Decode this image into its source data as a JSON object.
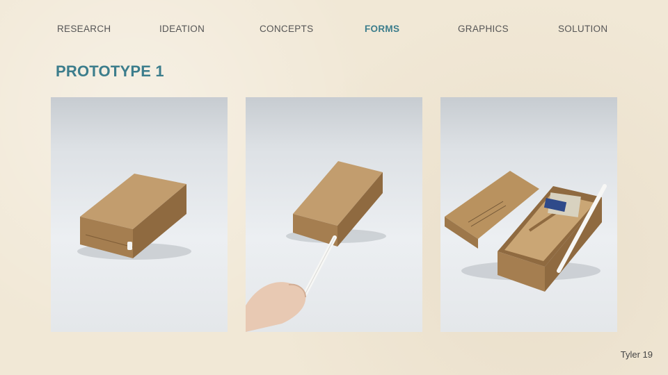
{
  "nav": {
    "items": [
      {
        "label": "RESEARCH"
      },
      {
        "label": "IDEATION"
      },
      {
        "label": "CONCEPTS"
      },
      {
        "label": "FORMS"
      },
      {
        "label": "GRAPHICS"
      },
      {
        "label": "SOLUTION"
      }
    ],
    "active_index": 3
  },
  "page": {
    "title": "PROTOTYPE 1",
    "footer": "Tyler 19"
  },
  "colors": {
    "accent": "#3c7d8c",
    "nav_text": "#555555",
    "background": "#f1e8d6",
    "cardboard": "#b38d5e"
  },
  "photos": [
    {
      "subject": "closed cardboard box"
    },
    {
      "subject": "box with stylus being pulled out"
    },
    {
      "subject": "open box with compartments"
    }
  ]
}
